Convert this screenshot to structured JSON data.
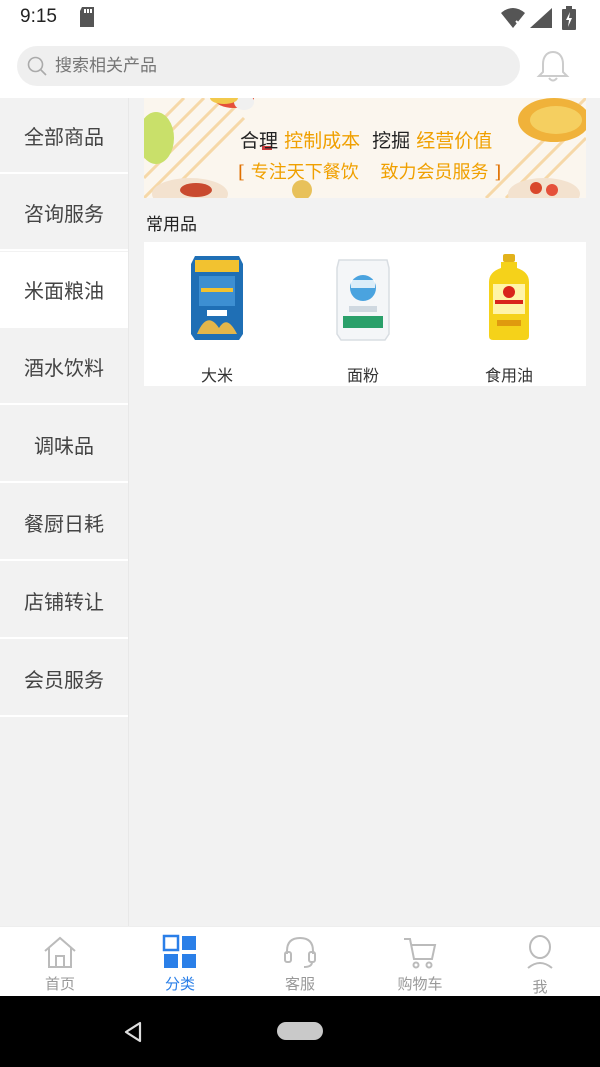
{
  "status_bar": {
    "time": "9:15"
  },
  "search": {
    "placeholder": "搜索相关产品"
  },
  "sidebar": {
    "items": [
      {
        "label": "全部商品"
      },
      {
        "label": "咨询服务"
      },
      {
        "label": "米面粮油",
        "active": true
      },
      {
        "label": "酒水饮料"
      },
      {
        "label": "调味品"
      },
      {
        "label": "餐厨日耗"
      },
      {
        "label": "店铺转让"
      },
      {
        "label": "会员服务"
      }
    ]
  },
  "banner": {
    "line1_a": "合理",
    "line1_b": "控制成本",
    "line1_c": "挖掘",
    "line1_d": "经营价值",
    "line2_a": "专注天下餐饮",
    "line2_b": "致力会员服务"
  },
  "section": {
    "title": "常用品"
  },
  "products": [
    {
      "label": "大米",
      "icon": "rice-bag-icon"
    },
    {
      "label": "面粉",
      "icon": "flour-bag-icon"
    },
    {
      "label": "食用油",
      "icon": "oil-bottle-icon"
    }
  ],
  "tabs": [
    {
      "label": "首页",
      "icon": "home-icon"
    },
    {
      "label": "分类",
      "icon": "category-grid-icon",
      "active": true
    },
    {
      "label": "客服",
      "icon": "headset-icon"
    },
    {
      "label": "购物车",
      "icon": "cart-icon"
    },
    {
      "label": "我",
      "icon": "user-icon"
    }
  ],
  "colors": {
    "accent": "#2a7fe8",
    "banner_orange": "#f0a000",
    "tab_inactive": "#999999"
  }
}
